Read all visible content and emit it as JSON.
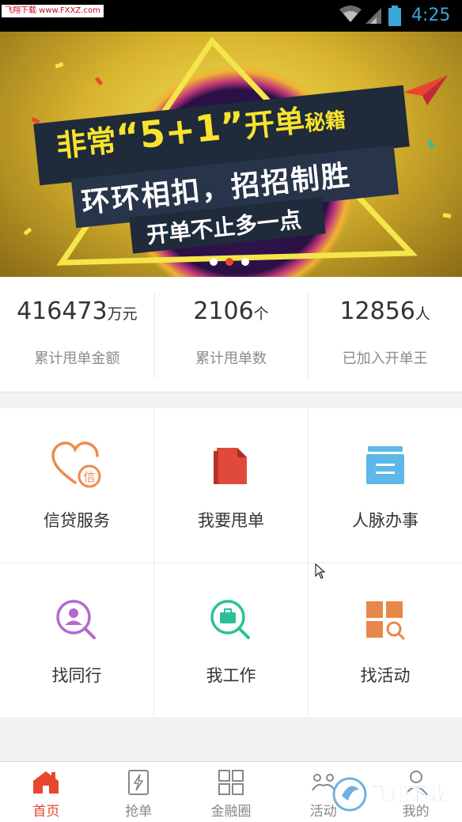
{
  "status_bar": {
    "watermark": "飞翔下载 www.FXXZ.com",
    "time": "4:25",
    "icons": [
      "wifi-icon",
      "signal-icon",
      "battery-icon"
    ]
  },
  "banner": {
    "line1_a": "非常",
    "line1_num": "“5+1”",
    "line1_b": "开单",
    "line1_small": "秘籍",
    "line2": "环环相扣，招招制胜",
    "line3": "开单不止多一点",
    "page_indicator": {
      "count": 3,
      "active_index": 1
    },
    "colors": {
      "background": "#e2c63a",
      "band": "#1f2a3a",
      "headline": "#f7e32c"
    }
  },
  "stats": [
    {
      "value": "416473",
      "unit": "万元",
      "label": "累计甩单金额"
    },
    {
      "value": "2106",
      "unit": "个",
      "label": "累计甩单数"
    },
    {
      "value": "12856",
      "unit": "人",
      "label": "已加入开单王"
    }
  ],
  "grid": [
    {
      "label": "信贷服务",
      "icon": "heart-credit-icon",
      "color": "#ef8a4c"
    },
    {
      "label": "我要甩单",
      "icon": "document-icon",
      "color": "#e04a3a"
    },
    {
      "label": "人脉办事",
      "icon": "drawer-icon",
      "color": "#5bb8e8"
    },
    {
      "label": "找同行",
      "icon": "search-person-icon",
      "color": "#b46ad0"
    },
    {
      "label": "我工作",
      "icon": "search-briefcase-icon",
      "color": "#2cc09a"
    },
    {
      "label": "找活动",
      "icon": "search-grid-icon",
      "color": "#e8874a"
    }
  ],
  "bottom_nav": [
    {
      "label": "首页",
      "icon": "home-icon",
      "active": true
    },
    {
      "label": "抢单",
      "icon": "grab-order-icon",
      "active": false
    },
    {
      "label": "金融圈",
      "icon": "grid-icon",
      "active": false
    },
    {
      "label": "活动",
      "icon": "activity-icon",
      "active": false
    },
    {
      "label": "我的",
      "icon": "profile-icon",
      "active": false
    }
  ],
  "overlay_watermark": "飞翔下载"
}
